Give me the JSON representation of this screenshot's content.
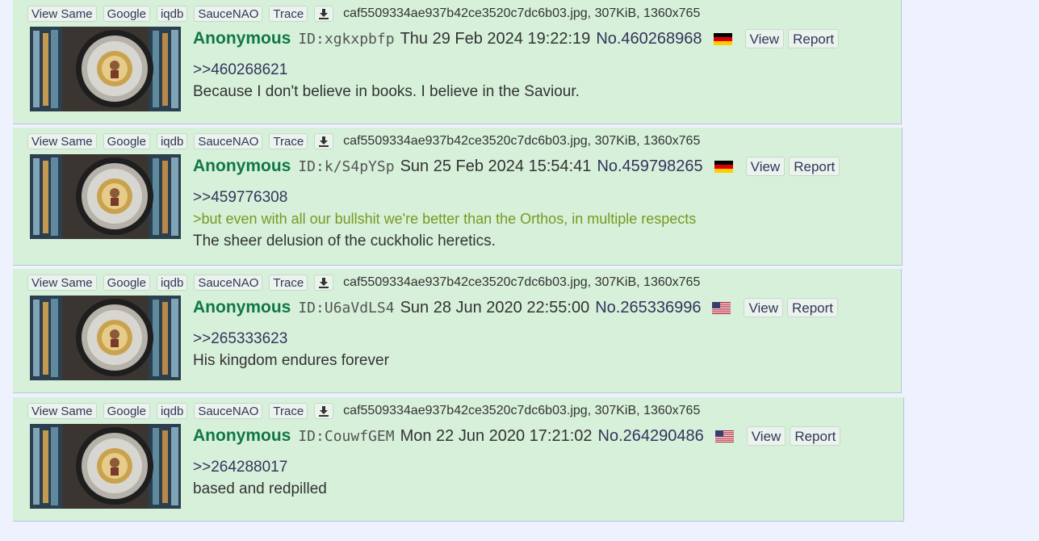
{
  "buttons": {
    "view_same": "View Same",
    "google": "Google",
    "iqdb": "iqdb",
    "saucenao": "SauceNAO",
    "trace": "Trace",
    "download_icon": "download-icon",
    "view": "View",
    "report": "Report"
  },
  "posts": [
    {
      "file_info": "caf5509334ae937b42ce3520c7dc6b03.jpg, 307KiB, 1360x765",
      "name": "Anonymous",
      "poster_id": "ID:xgkxpbfp",
      "datetime": "Thu 29 Feb 2024 19:22:19",
      "post_no": "No.460268968",
      "flag": "germany-flag",
      "quote_link": ">>460268621",
      "greentext": "",
      "text": "Because I don't believe in books. I believe in the Saviour."
    },
    {
      "file_info": "caf5509334ae937b42ce3520c7dc6b03.jpg, 307KiB, 1360x765",
      "name": "Anonymous",
      "poster_id": "ID:k/S4pYSp",
      "datetime": "Sun 25 Feb 2024 15:54:41",
      "post_no": "No.459798265",
      "flag": "germany-flag",
      "quote_link": ">>459776308",
      "greentext": ">but even with all our bullshit we're better than the Orthos, in multiple respects",
      "text": "The sheer delusion of the cuckholic heretics."
    },
    {
      "file_info": "caf5509334ae937b42ce3520c7dc6b03.jpg, 307KiB, 1360x765",
      "name": "Anonymous",
      "poster_id": "ID:U6aVdLS4",
      "datetime": "Sun 28 Jun 2020 22:55:00",
      "post_no": "No.265336996",
      "flag": "usa-flag",
      "quote_link": ">>265333623",
      "greentext": "",
      "text": "His kingdom endures forever"
    },
    {
      "file_info": "caf5509334ae937b42ce3520c7dc6b03.jpg, 307KiB, 1360x765",
      "name": "Anonymous",
      "poster_id": "ID:CouwfGEM",
      "datetime": "Mon 22 Jun 2020 17:21:02",
      "post_no": "No.264290486",
      "flag": "usa-flag",
      "quote_link": ">>264288017",
      "greentext": "",
      "text": "based and redpilled"
    }
  ]
}
